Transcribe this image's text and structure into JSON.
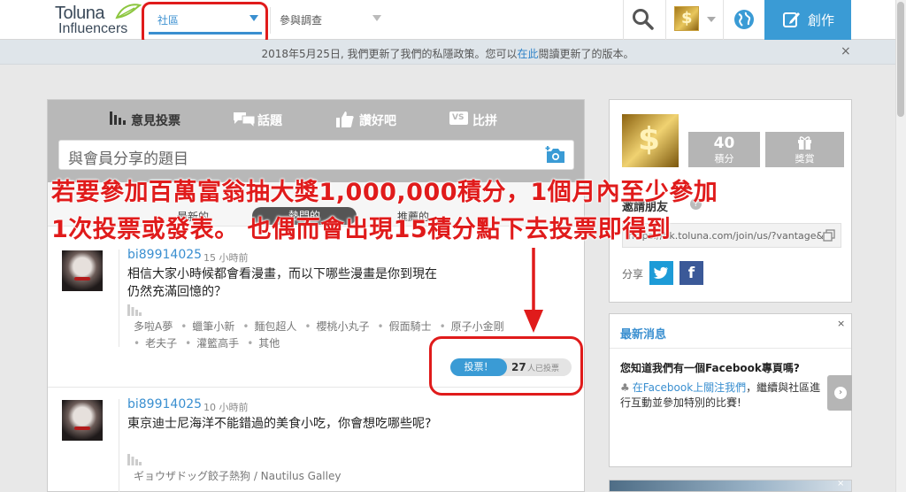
{
  "header": {
    "logo_line1": "Toluna",
    "logo_line2": "Influencers",
    "nav_community": "社區",
    "nav_survey": "參與調查",
    "create_label": "創作",
    "avatar_glyph": "$"
  },
  "notice": {
    "text_before": "2018年5月25日, 我們更新了我們的私隱政策。您可以",
    "link": "在此",
    "text_after": "閱讀更新了的版本。",
    "close": "×"
  },
  "feed": {
    "tabs": [
      "意見投票",
      "話題",
      "讚好吧",
      "比拼"
    ],
    "vs_glyph": "VS",
    "share_placeholder": "與會員分享的題目",
    "filters": [
      "最新的",
      "熱門的",
      "推薦的"
    ],
    "posts": [
      {
        "user": "bi89914025",
        "time": "15 小時前",
        "question": "相信大家小時候都會看漫畫，而以下哪些漫畫是你到現在仍然充滿回憶的？",
        "options": [
          "多啦A夢",
          "蠟筆小新",
          "麵包超人",
          "櫻桃小丸子",
          "假面騎士",
          "原子小金剛",
          "老夫子",
          "灌籃高手",
          "其他"
        ],
        "vote_button": "投票！",
        "vote_count": "27",
        "vote_count_label": "人已投票"
      },
      {
        "user": "bi89914025",
        "time": "10 小時前",
        "question": "東京迪士尼海洋不能錯過的美食小吃，你會想吃哪些呢?",
        "options": [
          "ギョウザドッグ餃子熱狗 / Nautilus Galley"
        ]
      }
    ]
  },
  "profile": {
    "avatar_glyph": "$",
    "points_value": "40",
    "points_label": "積分",
    "rewards_label": "獎賞",
    "invite_title": "邀請朋友",
    "invite_help": "?",
    "invite_link": "https://hk.toluna.com/join/us/?vantage&lh",
    "share_label": "分享",
    "fb_glyph": "f"
  },
  "news": {
    "title": "最新消息",
    "close": "×",
    "question": "您知道我們有一個Facebook專頁嗎?",
    "club_glyph": "♣",
    "link": "在Facebook上關注我們",
    "body": "，繼續與社區進行互動並參加特別的比賽!",
    "next_glyph": "›"
  },
  "annotation": {
    "line1": "若要參加百萬富翁抽大獎1,000,000積分，1個月內至少參加",
    "line2": "1次投票或發表。 也偶而會出現15積分點下去投票即得到"
  },
  "colors": {
    "accent": "#3a9bd5",
    "link": "#3a8fd0",
    "annotation": "#e01b1b",
    "facebook": "#3b5998",
    "twitter": "#1d9bd7"
  }
}
